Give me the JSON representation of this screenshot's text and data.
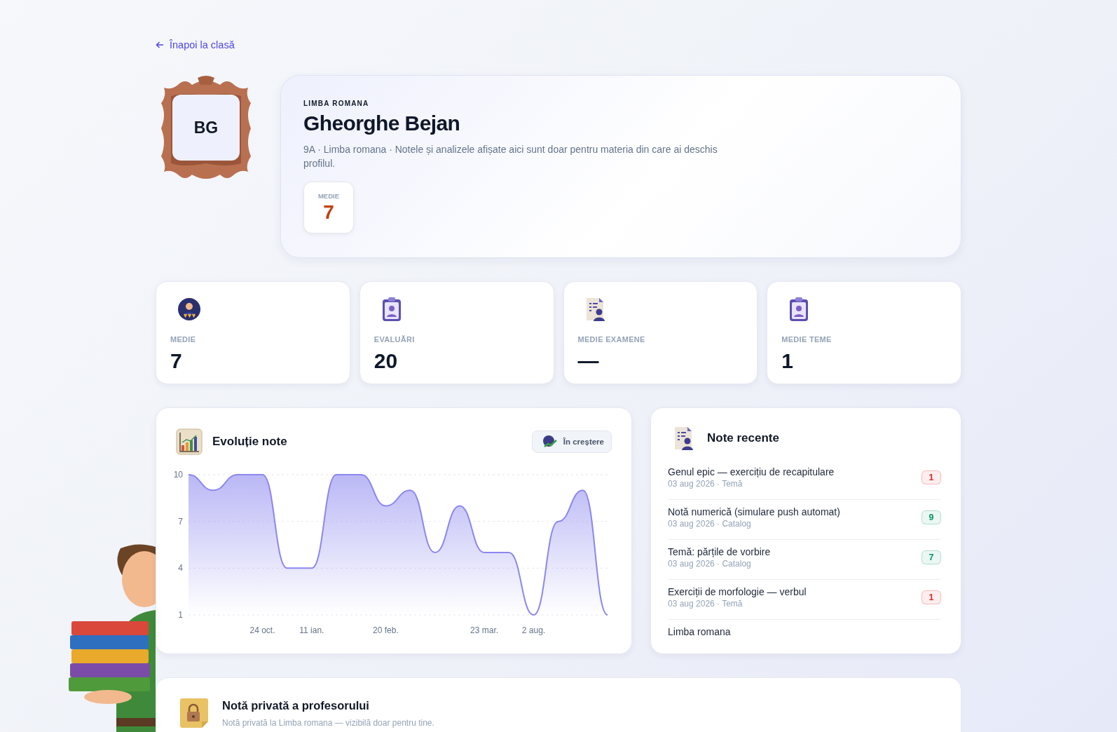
{
  "back_link": "Înapoi la clasă",
  "profile": {
    "initials": "BG",
    "subject": "LIMBA ROMANA",
    "name": "Gheorghe Bejan",
    "description": "9A · Limba romana · Notele și analizele afișate aici sunt doar pentru materia din care ai deschis profilul.",
    "average": {
      "label": "MEDIE",
      "value": "7"
    }
  },
  "stats": [
    {
      "kind": "medal",
      "label": "MEDIE",
      "value": "7"
    },
    {
      "kind": "clipboard",
      "label": "EVALUĂRI",
      "value": "20"
    },
    {
      "kind": "document",
      "label": "MEDIE EXAMENE",
      "value": "—"
    },
    {
      "kind": "clipboard",
      "label": "MEDIE TEME",
      "value": "1"
    }
  ],
  "evolution": {
    "title": "Evoluție note",
    "trend": "În creștere",
    "chart_data": {
      "type": "area",
      "categories": [
        null,
        null,
        null,
        "24 oct.",
        null,
        "11 ian.",
        null,
        null,
        "20 feb.",
        null,
        null,
        null,
        "23 mar.",
        null,
        "2 aug.",
        null,
        null,
        null
      ],
      "series": [
        {
          "color": "#8b87f0",
          "values": [
            10,
            9,
            10,
            10,
            4,
            4,
            10,
            10,
            8,
            9,
            5,
            8,
            5,
            5,
            1,
            7,
            9,
            1
          ]
        }
      ],
      "ylim": [
        1,
        10
      ],
      "yticks": [
        1,
        4,
        7,
        10
      ]
    }
  },
  "recent": {
    "title": "Note recente",
    "items": [
      {
        "title": "Genul epic — exercițiu de recapitulare",
        "meta": "03 aug 2026 · Temă",
        "grade": "1",
        "color": "#dc2626"
      },
      {
        "title": "Notă numerică (simulare push automat)",
        "meta": "03 aug 2026 · Catalog",
        "grade": "9",
        "color": "#059669"
      },
      {
        "title": "Temă: părțile de vorbire",
        "meta": "03 aug 2026 · Catalog",
        "grade": "7",
        "color": "#059669"
      },
      {
        "title": "Exerciții de morfologie — verbul",
        "meta": "03 aug 2026 · Temă",
        "grade": "1",
        "color": "#dc2626"
      },
      {
        "title": "Limba romana"
      }
    ]
  },
  "private_note": {
    "title": "Notă privată a profesorului",
    "subtitle": "Notă privată la Limba romana — vizibilă doar pentru tine."
  }
}
